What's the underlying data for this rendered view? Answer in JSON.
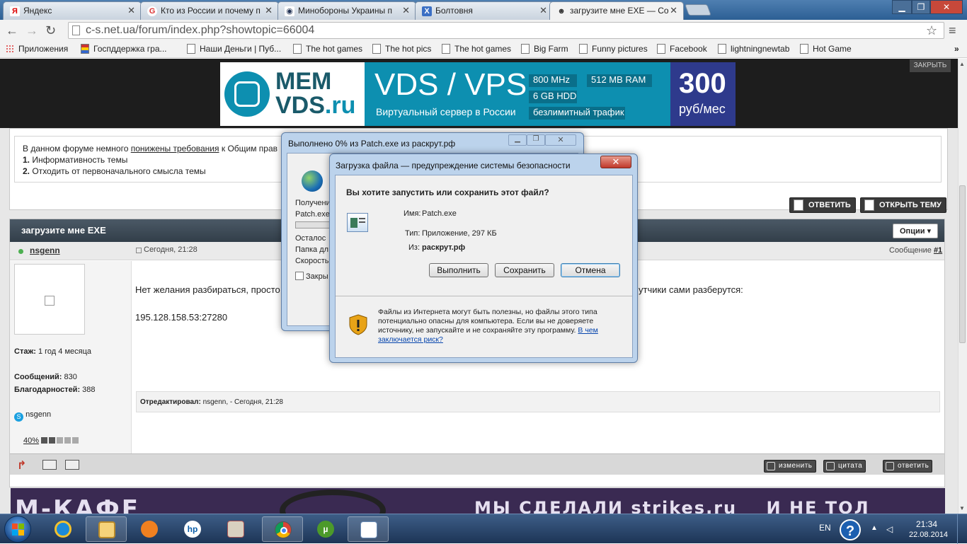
{
  "browser": {
    "tabs": [
      {
        "title": "Яндекс",
        "favicon": "Я"
      },
      {
        "title": "Кто из России и почему п",
        "favicon": "G"
      },
      {
        "title": "Минобороны Украины п",
        "favicon": "◉"
      },
      {
        "title": "Болтовня",
        "favicon": "Х"
      },
      {
        "title": "загрузите мне EXE — Co",
        "favicon": "☻"
      }
    ],
    "url": "c-s.net.ua/forum/index.php?showtopic=66004",
    "bookmarks": [
      "Приложения",
      "Госпддержка гра...",
      "Наши Деньги | Пуб...",
      "The hot games",
      "The hot pics",
      "The hot games",
      "Big Farm",
      "Funny pictures",
      "Facebook",
      "lightningnewtab",
      "Hot Game"
    ]
  },
  "ad_banner": {
    "logo_line1": "MEM",
    "logo_line2": "VDS",
    "logo_suffix": ".ru",
    "headline": "VDS / VPS",
    "subline": "Виртуальный сервер в России",
    "spec1": "800 MHz",
    "spec2": "512 MB RAM",
    "spec3": "6 GB HDD",
    "spec4": "безлимитный трафик",
    "price": "300",
    "price_unit": "руб/мес",
    "hide_label": "ЗАКРЫТЬ"
  },
  "rules_box": {
    "line1_prefix": "В данном форуме немного",
    "line1_link": "понижены требования",
    "line1_suffix": "к Общим прав",
    "item1_num": "1.",
    "item1": "Информативность темы",
    "item2_num": "2.",
    "item2": "Отходить от первоначального смысла темы"
  },
  "topic_buttons": {
    "reply": "ОТВЕТИТЬ",
    "new_topic": "ОТКРЫТЬ ТЕМУ"
  },
  "topic": {
    "title": "загрузите мне EXE",
    "options": "Опции"
  },
  "post": {
    "author": "nsgenn",
    "date": "Сегодня, 21:28",
    "post_label": "Сообщение",
    "post_num": "#1",
    "text_start": "Нет желания разбираться, просто",
    "text_end": "утчики сами разберутся:",
    "ip": "195.128.158.53:27280",
    "edited_label": "Отредактировал:",
    "edited_value": "nsgenn, - Сегодня, 21:28",
    "stazh_label": "Стаж:",
    "stazh_value": "1 год 4 месяца",
    "msgs_label": "Сообщений:",
    "msgs_value": "830",
    "thanks_label": "Благодарностей:",
    "thanks_value": "388",
    "skype": "nsgenn",
    "reputation": "40%",
    "reputation_fraction": 0.4,
    "btn_edit": "изменить",
    "btn_quote": "цитата",
    "btn_reply": "ответить"
  },
  "bottom_banner": {
    "left": "М-КАФЕ",
    "right": "МЫ СДЕЛАЛИ strikes.ru    И НЕ ТОЛ"
  },
  "progress_dialog": {
    "title": "Выполнено 0% из Patch.exe из раскрут.рф",
    "receiving": "Получени",
    "file": "Patch.exe",
    "remaining": "Осталос",
    "folder": "Папка дл",
    "speed": "Скорость",
    "close_check": "Закры"
  },
  "security_dialog": {
    "title": "Загрузка файла — предупреждение системы безопасности",
    "question": "Вы хотите запустить или сохранить этот файл?",
    "name_label": "Имя:",
    "name_value": "Patch.exe",
    "type_label": "Тип:",
    "type_value": "Приложение, 297 КБ",
    "from_label": "Из:",
    "from_value": "раскрут.рф",
    "btn_run": "Выполнить",
    "btn_save": "Сохранить",
    "btn_cancel": "Отмена",
    "warning_line1": "Файлы из Интернета могут быть полезны, но файлы этого типа",
    "warning_line2": "потенциально опасны для компьютера. Если вы не доверяете",
    "warning_line3": "источнику, не запускайте и не сохраняйте эту программу.",
    "warning_link1": "В чем",
    "warning_link2": "заключается риск?"
  },
  "taskbar": {
    "lang": "EN",
    "time": "21:34",
    "date": "22.08.2014"
  },
  "colors": {
    "accent": "#2f6fb0",
    "ad_teal": "#0d8fb0",
    "ad_price_bg": "#2e3a8c",
    "topic_bar": "#3b4a57",
    "online": "#4caf50"
  }
}
